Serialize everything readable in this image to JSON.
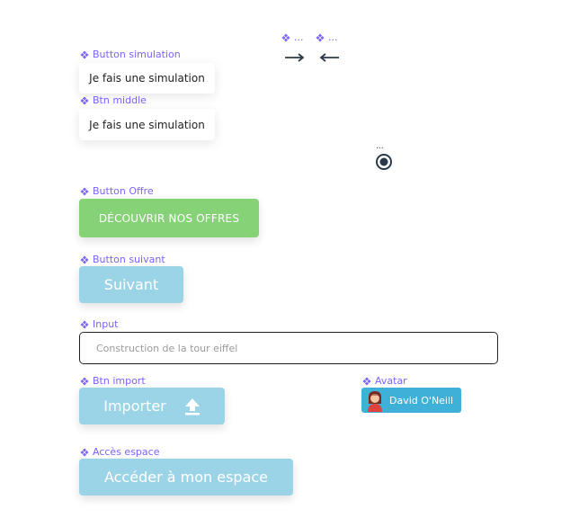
{
  "labels": {
    "button_simulation": "Button simulation",
    "btn_middle": "Btn middle",
    "button_offre": "Button Offre",
    "button_suivant": "Button suivant",
    "input": "Input",
    "btn_import": "Btn import",
    "avatar": "Avatar",
    "acces_espace": "Accès espace",
    "arrow_right": "...",
    "arrow_left": "..."
  },
  "buttons": {
    "simulation": "Je fais une simulation",
    "middle": "Je fais une simulation",
    "offre": "DÉCOUVRIR NOS OFFRES",
    "suivant": "Suivant",
    "import": "Importer",
    "espace": "Accéder à mon espace"
  },
  "input": {
    "placeholder": "Construction de la tour eiffel"
  },
  "avatar": {
    "name": "David O'Neill"
  },
  "radio": {
    "label": "..."
  },
  "colors": {
    "component_label": "#7b61ff",
    "green": "#86d276",
    "light_blue": "#9bd4e6",
    "avatar_blue": "#3fb0d8"
  },
  "icons": {
    "component": "component-icon",
    "arrow_right": "arrow-right-icon",
    "arrow_left": "arrow-left-icon",
    "upload": "upload-icon",
    "radio": "radio-selected-icon"
  }
}
